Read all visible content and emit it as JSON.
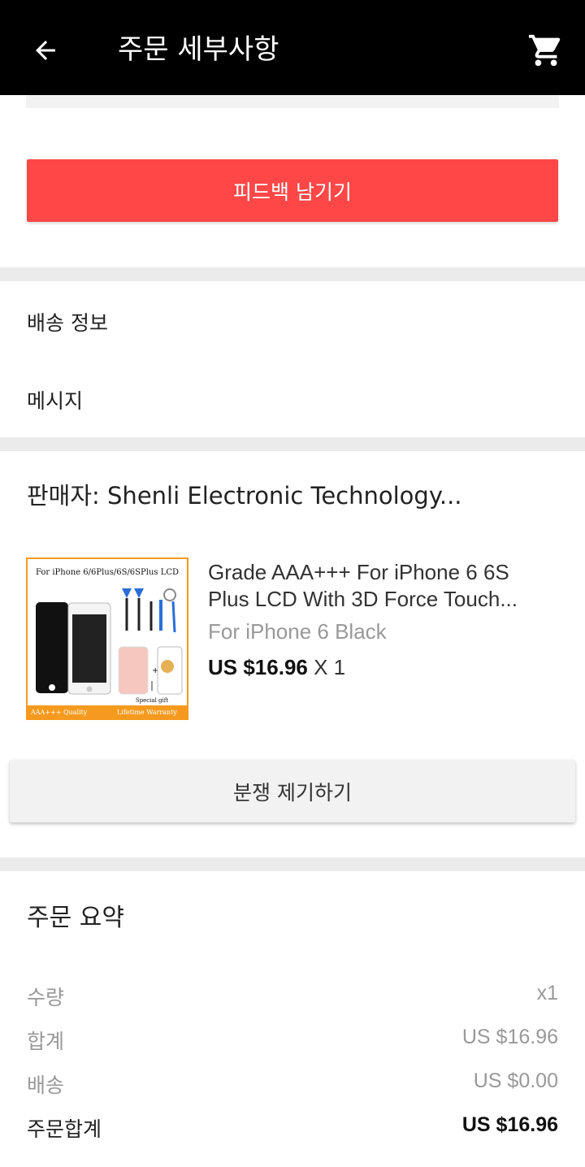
{
  "header": {
    "title": "주문 세부사항",
    "back_icon": "arrow-left-icon",
    "cart_icon": "shopping-cart-icon"
  },
  "actions": {
    "feedback_label": "피드백 남기기",
    "dispute_label": "분쟁 제기하기"
  },
  "info_rows": {
    "shipping": "배송 정보",
    "message": "메시지"
  },
  "seller": {
    "label": "판매자: Shenli Electronic Technology..."
  },
  "product": {
    "title": "Grade AAA+++ For iPhone 6 6S Plus LCD With 3D Force Touch...",
    "variant": "For iPhone 6 Black",
    "price": "US $16.96",
    "quantity": "X 1",
    "image": {
      "header_text": "For iPhone 6/6Plus/6S/6SPlus LCD",
      "gift_text": "Special gift",
      "badge_quality": "AAA+++ Quality",
      "badge_warranty": "Lifetime Warranty"
    }
  },
  "summary": {
    "title": "주문 요약",
    "rows": [
      {
        "label": "수량",
        "value": "x1"
      },
      {
        "label": "합계",
        "value": "US $16.96"
      },
      {
        "label": "배송",
        "value": "US $0.00"
      },
      {
        "label": "주문합계",
        "value": "US $16.96"
      }
    ]
  },
  "colors": {
    "appbar": "#000000",
    "accent": "#ff4747",
    "thumb_border": "#f59a1e"
  }
}
